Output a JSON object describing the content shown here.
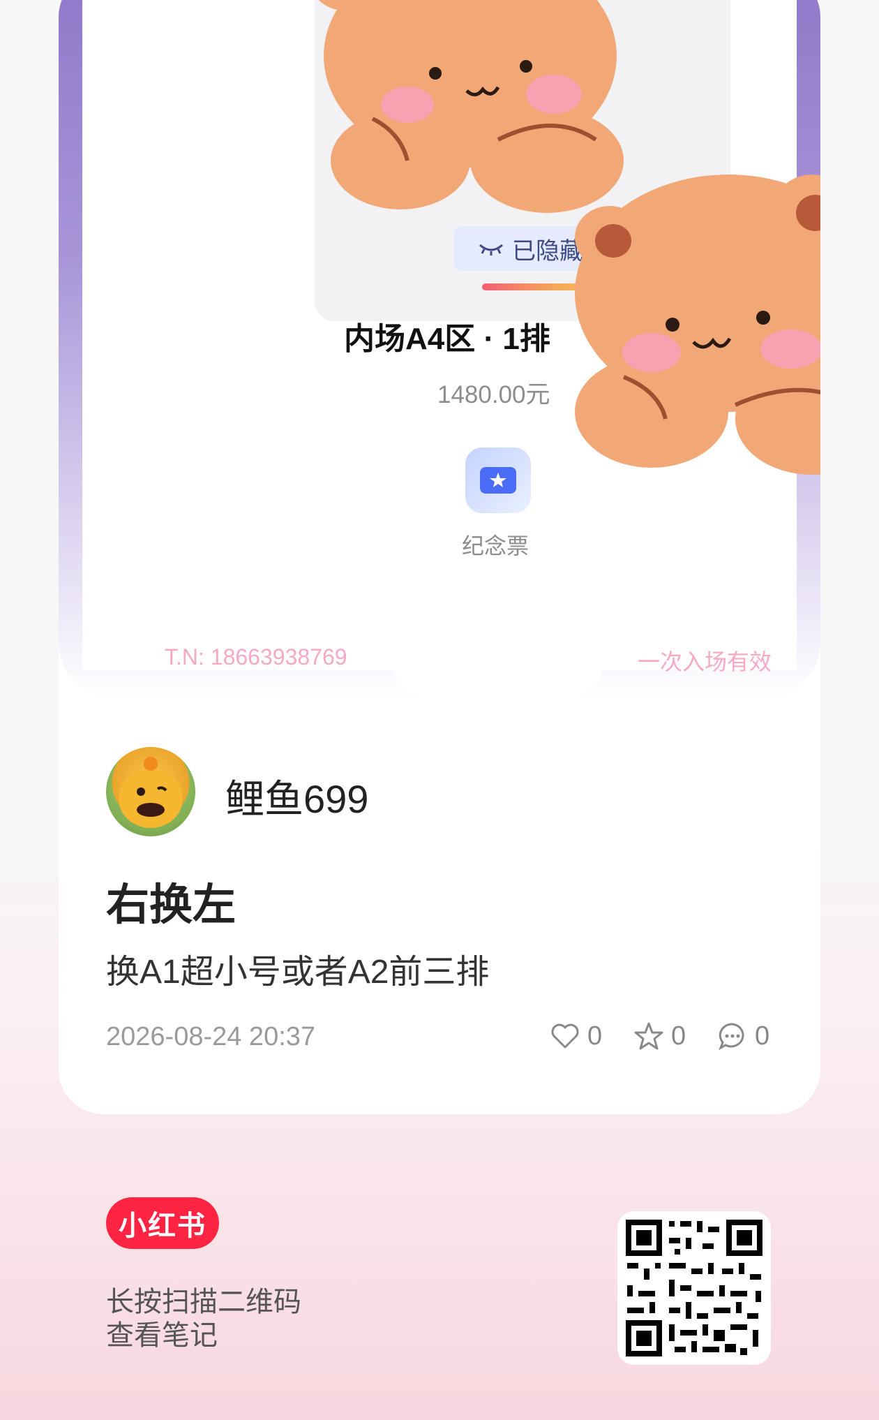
{
  "ticket": {
    "hidden_label": "已隐藏",
    "seat": "内场A4区 · 1排",
    "price": "1480.00元",
    "souvenir_label": "纪念票",
    "tn": "T.N:  18663938769",
    "entry_note": "一次入场有效"
  },
  "post": {
    "username": "鲤鱼699",
    "title": "右换左",
    "body": "换A1超小号或者A2前三排",
    "datetime": "2026-08-24 20:37",
    "likes": "0",
    "collects": "0",
    "comments": "0"
  },
  "footer": {
    "logo": "小红书",
    "line1": "长按扫描二维码",
    "line2": "查看笔记"
  },
  "colors": {
    "brand": "#ff2442",
    "frame": "#8f78c9",
    "accent_pink": "#f6a8c4"
  }
}
